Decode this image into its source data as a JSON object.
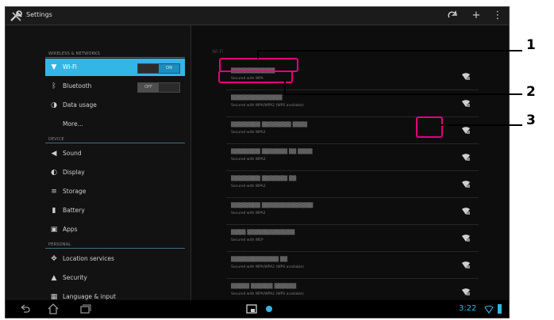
{
  "action_bar": {
    "title": "Settings",
    "icons": [
      "settings-tools-icon",
      "sync-icon",
      "add-icon",
      "overflow-menu-icon"
    ]
  },
  "left_pane": {
    "sections": {
      "wireless": "WIRELESS & NETWORKS",
      "device": "DEVICE",
      "personal": "PERSONAL"
    },
    "items": [
      {
        "label": "Wi-Fi",
        "icon": "wifi-icon",
        "toggle": "ON",
        "selected": true
      },
      {
        "label": "Bluetooth",
        "icon": "bluetooth-icon",
        "toggle": "OFF"
      },
      {
        "label": "Data usage",
        "icon": "data-usage-icon"
      },
      {
        "label": "More..."
      },
      {
        "label": "Sound",
        "icon": "sound-icon"
      },
      {
        "label": "Display",
        "icon": "display-icon"
      },
      {
        "label": "Storage",
        "icon": "storage-icon"
      },
      {
        "label": "Battery",
        "icon": "battery-icon"
      },
      {
        "label": "Apps",
        "icon": "apps-icon"
      },
      {
        "label": "Location services",
        "icon": "location-icon"
      },
      {
        "label": "Security",
        "icon": "lock-icon"
      },
      {
        "label": "Language & input",
        "icon": "keyboard-icon"
      }
    ]
  },
  "right_pane": {
    "header": "Wi-Fi",
    "networks": [
      {
        "name": "▒▒▒▒▒▒▒▒▒▒▒▒",
        "security": "Secured with WPA"
      },
      {
        "name": "▒▒▒▒▒▒▒▒▒▒▒▒▒▒",
        "security": "Secured with WPA/WPA2 (WPS available)"
      },
      {
        "name": "▒▒▒▒▒▒▒▒ ▒▒▒▒▒▒▒▒ ▒▒▒▒",
        "security": "Secured with WPA2"
      },
      {
        "name": "▒▒▒▒▒▒▒▒ ▒▒▒▒▒▒▒ ▒▒ ▒▒▒▒",
        "security": "Secured with WPA2"
      },
      {
        "name": "▒▒▒▒▒▒▒▒ ▒▒▒▒▒▒▒ ▒▒",
        "security": "Secured with WPA2"
      },
      {
        "name": "▒▒▒▒▒▒▒▒ ▒▒▒▒▒▒▒▒▒▒▒▒▒▒",
        "security": "Secured with WPA2"
      },
      {
        "name": "▒▒▒▒ ▒▒▒▒▒▒▒▒▒▒▒▒▒",
        "security": "Secured with WEP"
      },
      {
        "name": "▒▒▒▒▒▒▒▒▒▒▒▒▒ ▒▒",
        "security": "Secured with WPA/WPA2 (WPS available)"
      },
      {
        "name": "▒▒▒▒▒ ▒▒▒▒▒▒ ▒▒▒▒▒▒",
        "security": "Secured with WPA/WPA2 (WPS available)"
      }
    ]
  },
  "nav_bar": {
    "time": "3:22",
    "icons": [
      "back-icon",
      "home-icon",
      "recent-apps-icon",
      "screenshot-icon",
      "app-notification-icon",
      "battery-status-icon"
    ]
  },
  "callouts": [
    "1",
    "2",
    "3"
  ],
  "colors": {
    "accent": "#33b5e5",
    "callout": "#e5007e"
  }
}
